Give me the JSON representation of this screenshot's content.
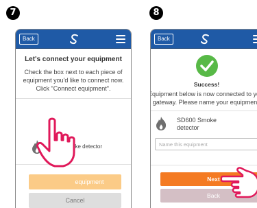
{
  "steps": {
    "left_number": "7",
    "right_number": "8"
  },
  "left_screen": {
    "back_label": "Back",
    "title": "Let's connect your equipment",
    "description": "Check the box next to each piece of equipment you'd like to connect now. Click \"Connect equipment\".",
    "equipment_label": "Smoke detector",
    "checkbox_checked": false,
    "connect_visible_label": "equipment",
    "cancel_label": "Cancel"
  },
  "right_screen": {
    "back_label": "Back",
    "success_title": "Success!",
    "description": "Equipment below is now connected to your gateway. Please name your equipment.",
    "equipment_name": "SD600 Smoke detector",
    "name_placeholder": "Name this equipment",
    "next_label": "Next",
    "back_button_label": "Back"
  },
  "colors": {
    "app_bar": "#1f5aa6",
    "accent_orange": "#f47a22",
    "disabled_orange": "#fbcb87",
    "success_green": "#58b947",
    "cancel_gray": "#dedede",
    "back_mauve": "#d4bfc5"
  },
  "icons": [
    "menu-icon",
    "logo-icon",
    "flame-icon",
    "checkmark-icon",
    "pointing-hand-icon"
  ]
}
